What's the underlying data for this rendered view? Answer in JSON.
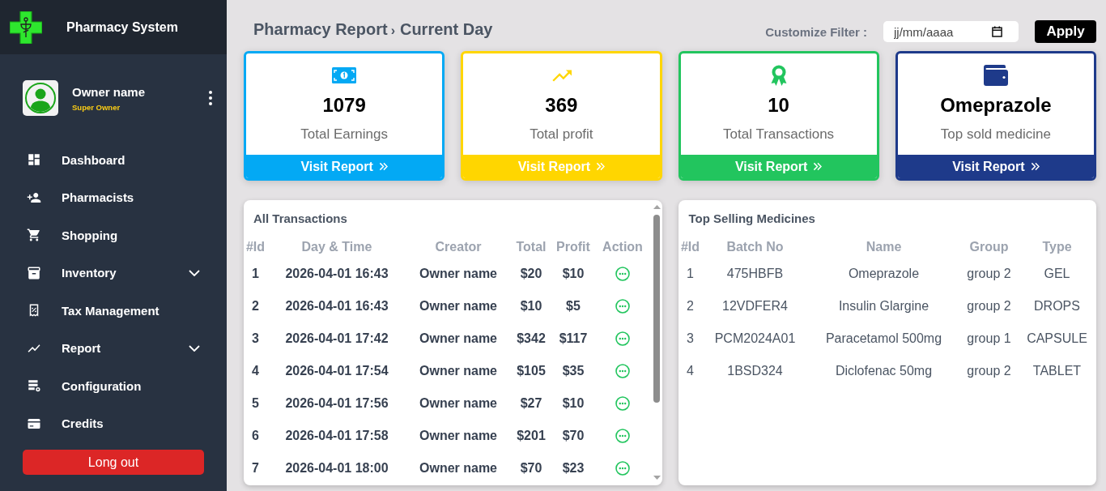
{
  "sidebar": {
    "brand": "Pharmacy System",
    "user": {
      "name": "Owner name",
      "role": "Super Owner"
    },
    "items": [
      {
        "label": "Dashboard",
        "submenu": false,
        "selected": false
      },
      {
        "label": "Pharmacists",
        "submenu": false,
        "selected": false
      },
      {
        "label": "Shopping",
        "submenu": false,
        "selected": false
      },
      {
        "label": "Inventory",
        "submenu": true,
        "selected": false
      },
      {
        "label": "Tax Management",
        "submenu": false,
        "selected": false
      },
      {
        "label": "Report",
        "submenu": true,
        "selected": false
      },
      {
        "label": "Configuration",
        "submenu": false,
        "selected": false
      },
      {
        "label": "Credits",
        "submenu": false,
        "selected": false
      }
    ],
    "logout": "Long out"
  },
  "header": {
    "breadcrumb": [
      "Pharmacy Report",
      "Current Day"
    ],
    "separator": "›",
    "filter": {
      "label": "Customize Filter :",
      "date": {
        "placeholder": "jj/mm/aaaa"
      },
      "button": "Apply"
    }
  },
  "cards": [
    {
      "value": "1079",
      "label": "Total Earnings",
      "link": "Visit Report",
      "color": "#03a9f4"
    },
    {
      "value": "369",
      "label": "Total profit",
      "link": "Visit Report",
      "color": "#ffd600"
    },
    {
      "value": "10",
      "label": "Total Transactions",
      "link": "Visit Report",
      "color": "#22c55e"
    },
    {
      "value": "Omeprazole",
      "label": "Top sold medicine",
      "link": "Visit Report",
      "color": "#1e3a8a"
    }
  ],
  "transactions": {
    "title": "All Transactions",
    "columns": [
      "#Id",
      "Day & Time",
      "Creator",
      "Total",
      "Profit",
      "Action"
    ],
    "rows": [
      {
        "id": "1",
        "datetime": "2026-04-01 16:43",
        "creator": "Owner name",
        "total": "$20",
        "profit": "$10"
      },
      {
        "id": "2",
        "datetime": "2026-04-01 16:43",
        "creator": "Owner name",
        "total": "$10",
        "profit": "$5"
      },
      {
        "id": "3",
        "datetime": "2026-04-01 17:42",
        "creator": "Owner name",
        "total": "$342",
        "profit": "$117"
      },
      {
        "id": "4",
        "datetime": "2026-04-01 17:54",
        "creator": "Owner name",
        "total": "$105",
        "profit": "$35"
      },
      {
        "id": "5",
        "datetime": "2026-04-01 17:56",
        "creator": "Owner name",
        "total": "$27",
        "profit": "$10"
      },
      {
        "id": "6",
        "datetime": "2026-04-01 17:58",
        "creator": "Owner name",
        "total": "$201",
        "profit": "$70"
      },
      {
        "id": "7",
        "datetime": "2026-04-01 18:00",
        "creator": "Owner name",
        "total": "$70",
        "profit": "$23"
      }
    ]
  },
  "top_selling": {
    "title": "Top Selling Medicines",
    "columns": [
      "#Id",
      "Batch No",
      "Name",
      "Group",
      "Type"
    ],
    "rows": [
      {
        "id": "1",
        "batch": "475HBFB",
        "name": "Omeprazole",
        "group": "group 2",
        "type": "GEL"
      },
      {
        "id": "2",
        "batch": "12VDFER4",
        "name": "Insulin Glargine",
        "group": "group 2",
        "type": "DROPS"
      },
      {
        "id": "3",
        "batch": "PCM2024A01",
        "name": "Paracetamol 500mg",
        "group": "group 1",
        "type": "CAPSULE"
      },
      {
        "id": "4",
        "batch": "1BSD324",
        "name": "Diclofenac 50mg",
        "group": "group 2",
        "type": "TABLET"
      }
    ]
  }
}
